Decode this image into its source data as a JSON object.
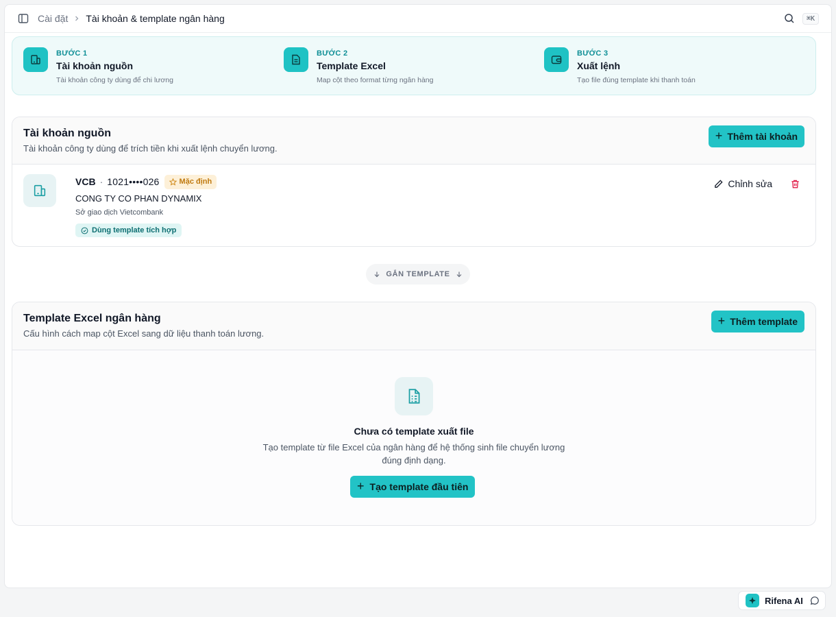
{
  "breadcrumb": {
    "root": "Cài đặt",
    "current": "Tài khoản & template ngân hàng"
  },
  "search": {
    "shortcut": "⌘K"
  },
  "steps": [
    {
      "label": "BƯỚC 1",
      "title": "Tài khoản nguồn",
      "desc": "Tài khoản công ty dùng để chi lương",
      "icon": "building-icon"
    },
    {
      "label": "BƯỚC 2",
      "title": "Template Excel",
      "desc": "Map cột theo format từng ngân hàng",
      "icon": "file-spreadsheet-icon"
    },
    {
      "label": "BƯỚC 3",
      "title": "Xuất lệnh",
      "desc": "Tạo file đúng template khi thanh toán",
      "icon": "wallet-icon"
    }
  ],
  "accounts_card": {
    "title": "Tài khoản nguồn",
    "subtitle": "Tài khoản công ty dùng để trích tiền khi xuất lệnh chuyển lương.",
    "add_button": "Thêm tài khoản",
    "accounts": [
      {
        "bank": "VCB",
        "number": "1021••••026",
        "default_badge": "Mặc định",
        "company": "CONG TY CO PHAN DYNAMIX",
        "branch": "Sở giao dịch Vietcombank",
        "template_badge": "Dùng template tích hợp",
        "edit_label": "Chỉnh sửa"
      }
    ]
  },
  "connector": {
    "label": "GẮN TEMPLATE"
  },
  "templates_card": {
    "title": "Template Excel ngân hàng",
    "subtitle": "Cấu hình cách map cột Excel sang dữ liệu thanh toán lương.",
    "add_button": "Thêm template",
    "empty": {
      "title": "Chưa có template xuất file",
      "desc": "Tạo template từ file Excel của ngân hàng để hệ thống sinh file chuyển lương đúng định dạng.",
      "button": "Tạo template đầu tiên"
    }
  },
  "ai_widget": {
    "label": "Rifena AI"
  },
  "colors": {
    "accent": "#22c3c6",
    "accent_dark": "#0f8f96",
    "warning": "#c07a10",
    "danger": "#e11d48"
  }
}
